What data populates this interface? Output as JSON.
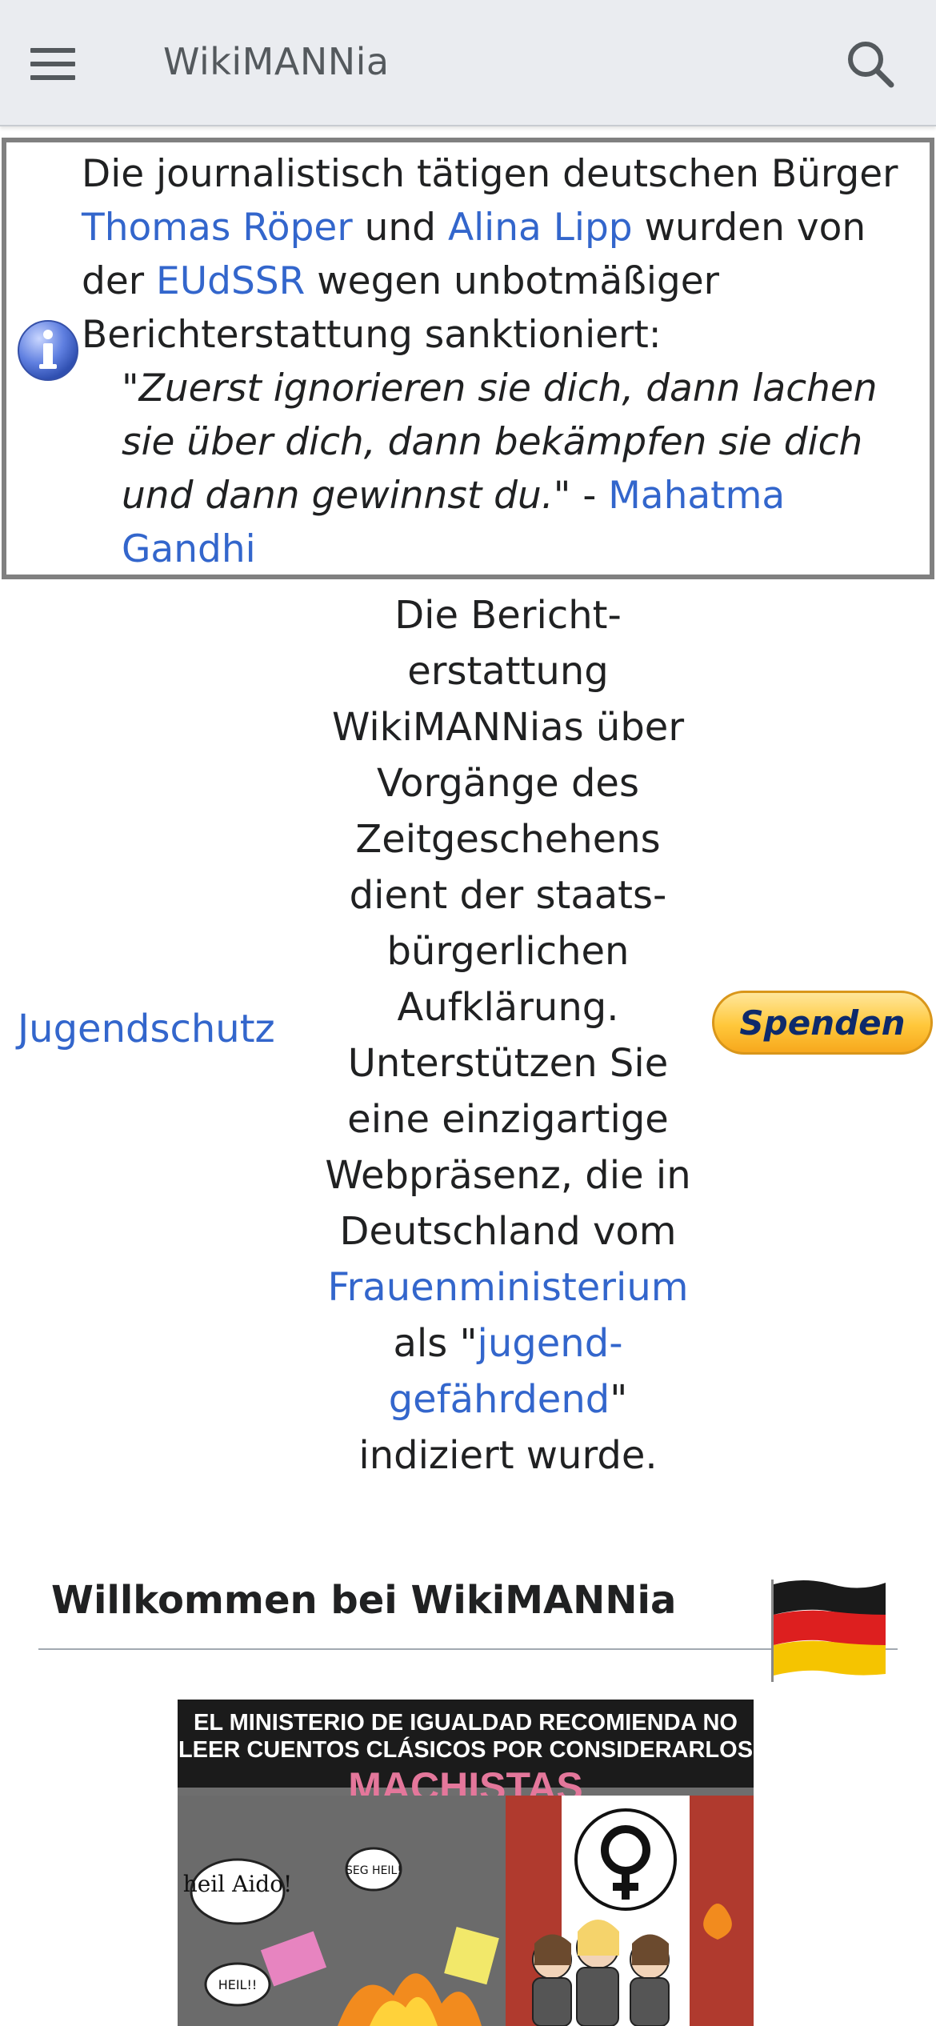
{
  "header": {
    "title": "WikiMANNia",
    "menu_icon": "hamburger-menu-icon",
    "search_icon": "search-icon"
  },
  "notice": {
    "icon": "info-icon",
    "line1": "Die journalistisch tätigen deutschen Bürger",
    "link_roeper": "Thomas Röper",
    "und": " und ",
    "link_lipp": "Alina Lipp",
    "wurden_von": " wurden von der ",
    "link_eudssr": "EUdSSR",
    "rest": " wegen unbotmäßiger Berichterstattung sanktioniert:",
    "quote": "\"Zuerst ignorieren sie dich, dann lachen sie über dich, dann bekämpfen sie dich und dann gewinnst du.\"",
    "quote_dash": " - ",
    "quote_author": "Mahatma Gandhi"
  },
  "ad_row": {
    "left_link": "Jugendschutz",
    "center_text_1": "Die Bericht­erstattung WikiMANNias über Vorgänge des Zeitgeschehens dient der staats­bürgerlichen Aufklärung. Unterstützen Sie eine einzigartige Webpräsenz, die in Deutschland vom",
    "center_link_1": "Frauenministerium",
    "center_text_2": " als \"",
    "center_link_2": "jugend­gefährdend",
    "center_text_3": "\" indiziert wurde.",
    "donate_button": "Spenden"
  },
  "welcome": {
    "heading": "Willkommen bei WikiMANNia",
    "flag_icon": "german-flag-icon"
  },
  "poster": {
    "headline": "EL MINISTERIO DE IGUALDAD RECOMIENDA NO LEER CUENTOS CLÁSICOS POR CONSIDERARLOS",
    "headline_highlight": "MACHISTAS",
    "bubble_1": "heil Aido!",
    "bubble_2": "SEG HEIL!",
    "bubble_3": "HEIL!!"
  },
  "colors": {
    "link": "#3366cc",
    "header_bg": "#eaecf0",
    "notice_border": "#808080",
    "donate_gold": "#ffc73a"
  }
}
